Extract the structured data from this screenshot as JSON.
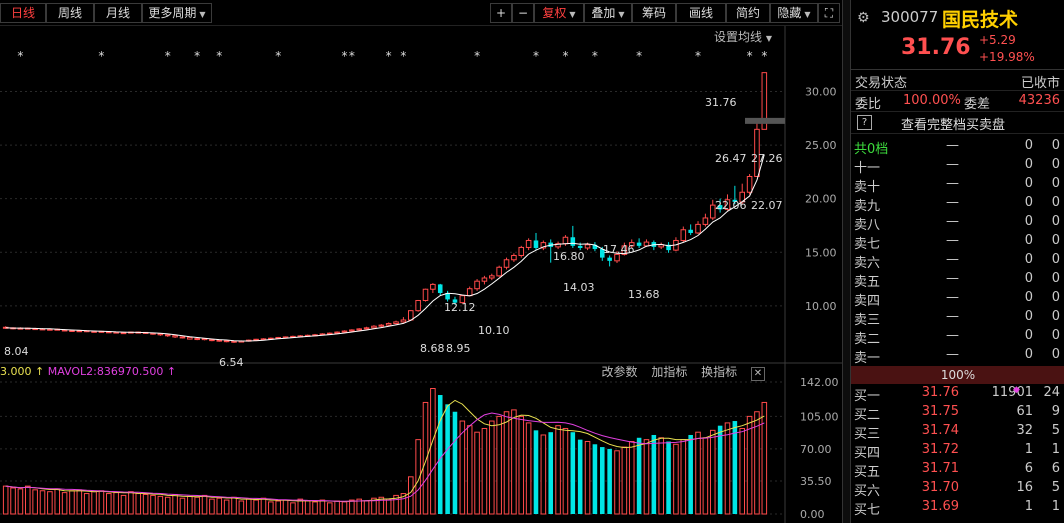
{
  "toolbar": {
    "left_tabs": [
      "日线",
      "周线",
      "月线",
      "更多周期"
    ],
    "plus": "+",
    "minus": "−",
    "fuquan": "复权",
    "diejia": "叠加",
    "chouma": "筹码",
    "huaxian": "画线",
    "jianyue": "简约",
    "yincang": "隐藏",
    "expand": "⛶"
  },
  "ma_settings_label": "设置均线",
  "volume_panel": {
    "legend_m1": "3.000 ↑",
    "legend_m2": "MAVOL2:836970.500 ↑",
    "btn_params": "改参数",
    "btn_add": "加指标",
    "btn_swap": "换指标",
    "close": "✕"
  },
  "header": {
    "code": "300077",
    "name": "国民技术",
    "price": "31.76",
    "change": "+5.29",
    "change_pct": "+19.98%"
  },
  "status": {
    "label": "交易状态",
    "value": "已收市"
  },
  "ratio": {
    "label1": "委比",
    "value1": "100.00%",
    "label2": "委差",
    "value2": "43236"
  },
  "full_book_link": "查看完整档买卖盘",
  "qmark": "?",
  "sell_levels": [
    {
      "name": "共0档",
      "price": "—",
      "vol": "0",
      "cnt": "0"
    },
    {
      "name": "十一",
      "price": "—",
      "vol": "0",
      "cnt": "0"
    },
    {
      "name": "卖十",
      "price": "—",
      "vol": "0",
      "cnt": "0"
    },
    {
      "name": "卖九",
      "price": "—",
      "vol": "0",
      "cnt": "0"
    },
    {
      "name": "卖八",
      "price": "—",
      "vol": "0",
      "cnt": "0"
    },
    {
      "name": "卖七",
      "price": "—",
      "vol": "0",
      "cnt": "0"
    },
    {
      "name": "卖六",
      "price": "—",
      "vol": "0",
      "cnt": "0"
    },
    {
      "name": "卖五",
      "price": "—",
      "vol": "0",
      "cnt": "0"
    },
    {
      "name": "卖四",
      "price": "—",
      "vol": "0",
      "cnt": "0"
    },
    {
      "name": "卖三",
      "price": "—",
      "vol": "0",
      "cnt": "0"
    },
    {
      "name": "卖二",
      "price": "—",
      "vol": "0",
      "cnt": "0"
    },
    {
      "name": "卖一",
      "price": "—",
      "vol": "0",
      "cnt": "0"
    }
  ],
  "pct_label": "100%",
  "buy_levels": [
    {
      "name": "买一",
      "price": "31.76",
      "vol": "11901",
      "cnt": "24",
      "flag": "◆"
    },
    {
      "name": "买二",
      "price": "31.75",
      "vol": "61",
      "cnt": "9",
      "flag": "◆"
    },
    {
      "name": "买三",
      "price": "31.74",
      "vol": "32",
      "cnt": "5",
      "flag": "◆"
    },
    {
      "name": "买四",
      "price": "31.72",
      "vol": "1",
      "cnt": "1",
      "flag": "◆"
    },
    {
      "name": "买五",
      "price": "31.71",
      "vol": "6",
      "cnt": "6",
      "flag": "◆"
    },
    {
      "name": "买六",
      "price": "31.70",
      "vol": "16",
      "cnt": "5",
      "flag": "◆"
    },
    {
      "name": "买七",
      "price": "31.69",
      "vol": "1",
      "cnt": "1",
      "flag": "◆"
    }
  ],
  "colors": {
    "up": "#ff4a4a",
    "down": "#00e5e5",
    "ma1": "#ffffff",
    "vol_ma1": "#e8e050",
    "vol_ma2": "#e040e0"
  },
  "chart_data": [
    {
      "type": "candlestick",
      "y_axis_ticks": [
        "30.00",
        "25.00",
        "20.00",
        "15.00",
        "10.00"
      ],
      "ylim": [
        7.0,
        33.5
      ],
      "annotations": [
        "31.76",
        "26.47",
        "27.26",
        "22.06",
        "22.07",
        "17.46",
        "16.80",
        "14.03",
        "13.68",
        "12.12",
        "10.10",
        "8.04",
        "6.54",
        "8.68",
        "8.95"
      ],
      "markers": [
        "*",
        "*",
        "*",
        "*",
        "*",
        "*",
        "*",
        "*",
        "*",
        "*",
        "*",
        "*",
        "*",
        "*"
      ],
      "candles": [
        [
          8.0,
          7.95,
          8.1,
          7.85,
          1
        ],
        [
          7.95,
          7.9,
          8.0,
          7.8,
          1
        ],
        [
          7.9,
          7.92,
          8.0,
          7.85,
          1
        ],
        [
          7.92,
          7.88,
          7.98,
          7.8,
          1
        ],
        [
          7.88,
          7.85,
          7.95,
          7.78,
          1
        ],
        [
          7.85,
          7.8,
          7.92,
          7.75,
          1
        ],
        [
          7.8,
          7.82,
          7.9,
          7.72,
          1
        ],
        [
          7.82,
          7.75,
          7.88,
          7.7,
          1
        ],
        [
          7.75,
          7.7,
          7.82,
          7.62,
          1
        ],
        [
          7.7,
          7.65,
          7.75,
          7.58,
          1
        ],
        [
          7.65,
          7.68,
          7.75,
          7.6,
          1
        ],
        [
          7.68,
          7.6,
          7.72,
          7.55,
          1
        ],
        [
          7.6,
          7.62,
          7.7,
          7.55,
          1
        ],
        [
          7.62,
          7.58,
          7.66,
          7.5,
          1
        ],
        [
          7.58,
          7.55,
          7.62,
          7.48,
          1
        ],
        [
          7.55,
          7.5,
          7.6,
          7.42,
          1
        ],
        [
          7.5,
          7.48,
          7.55,
          7.4,
          1
        ],
        [
          7.48,
          7.55,
          7.6,
          7.42,
          1
        ],
        [
          7.55,
          7.52,
          7.6,
          7.45,
          1
        ],
        [
          7.52,
          7.45,
          7.56,
          7.38,
          1
        ],
        [
          7.45,
          7.4,
          7.5,
          7.3,
          1
        ],
        [
          7.4,
          7.3,
          7.45,
          7.2,
          1
        ],
        [
          7.3,
          7.22,
          7.35,
          7.1,
          1
        ],
        [
          7.22,
          7.1,
          7.28,
          7.0,
          1
        ],
        [
          7.1,
          7.05,
          7.15,
          6.95,
          1
        ],
        [
          7.05,
          6.9,
          7.1,
          6.85,
          1
        ],
        [
          6.9,
          6.95,
          7.0,
          6.8,
          1
        ],
        [
          6.95,
          6.85,
          7.0,
          6.78,
          1
        ],
        [
          6.85,
          6.8,
          6.9,
          6.7,
          1
        ],
        [
          6.8,
          6.75,
          6.86,
          6.65,
          1
        ],
        [
          6.75,
          6.7,
          6.8,
          6.6,
          1
        ],
        [
          6.7,
          6.62,
          6.75,
          6.54,
          1
        ],
        [
          6.62,
          6.72,
          6.78,
          6.58,
          1
        ],
        [
          6.72,
          6.8,
          6.86,
          6.66,
          1
        ],
        [
          6.8,
          6.88,
          6.92,
          6.75,
          1
        ],
        [
          6.88,
          6.92,
          6.98,
          6.82,
          1
        ],
        [
          6.92,
          6.98,
          7.05,
          6.88,
          1
        ],
        [
          6.98,
          7.05,
          7.1,
          6.92,
          1
        ],
        [
          7.05,
          7.1,
          7.15,
          7.0,
          1
        ],
        [
          7.1,
          7.15,
          7.22,
          7.05,
          1
        ],
        [
          7.15,
          7.2,
          7.28,
          7.1,
          1
        ],
        [
          7.2,
          7.25,
          7.32,
          7.15,
          1
        ],
        [
          7.25,
          7.3,
          7.38,
          7.2,
          1
        ],
        [
          7.3,
          7.38,
          7.45,
          7.25,
          1
        ],
        [
          7.38,
          7.45,
          7.52,
          7.32,
          1
        ],
        [
          7.45,
          7.55,
          7.62,
          7.4,
          1
        ],
        [
          7.55,
          7.65,
          7.72,
          7.5,
          1
        ],
        [
          7.65,
          7.75,
          7.82,
          7.6,
          1
        ],
        [
          7.75,
          7.85,
          7.92,
          7.7,
          1
        ],
        [
          7.85,
          7.95,
          8.05,
          7.8,
          1
        ],
        [
          7.95,
          8.1,
          8.2,
          7.9,
          1
        ],
        [
          8.1,
          8.2,
          8.3,
          8.02,
          1
        ],
        [
          8.2,
          8.35,
          8.45,
          8.12,
          1
        ],
        [
          8.35,
          8.5,
          8.62,
          8.28,
          1
        ],
        [
          8.5,
          8.68,
          8.95,
          8.42,
          1
        ],
        [
          8.68,
          9.55,
          9.6,
          8.6,
          1
        ],
        [
          9.55,
          10.5,
          10.55,
          9.45,
          1
        ],
        [
          10.5,
          11.55,
          11.6,
          10.4,
          1
        ],
        [
          11.55,
          12.0,
          12.12,
          11.2,
          1
        ],
        [
          12.0,
          11.2,
          12.05,
          11.0,
          0
        ],
        [
          11.2,
          10.6,
          11.4,
          10.4,
          0
        ],
        [
          10.6,
          10.3,
          10.85,
          10.1,
          0
        ],
        [
          10.3,
          10.95,
          11.05,
          10.2,
          1
        ],
        [
          10.95,
          11.6,
          11.8,
          10.9,
          1
        ],
        [
          11.6,
          12.3,
          12.5,
          11.4,
          1
        ],
        [
          12.3,
          12.6,
          12.8,
          12.0,
          1
        ],
        [
          12.6,
          12.8,
          13.0,
          12.4,
          1
        ],
        [
          12.8,
          13.6,
          13.75,
          12.7,
          1
        ],
        [
          13.6,
          14.3,
          14.5,
          13.4,
          1
        ],
        [
          14.3,
          14.7,
          14.9,
          14.1,
          1
        ],
        [
          14.7,
          15.45,
          15.6,
          14.5,
          1
        ],
        [
          15.45,
          16.1,
          16.3,
          15.2,
          1
        ],
        [
          16.1,
          15.4,
          16.8,
          15.2,
          0
        ],
        [
          15.4,
          15.9,
          16.1,
          15.2,
          1
        ],
        [
          15.9,
          15.5,
          16.2,
          14.03,
          0
        ],
        [
          15.5,
          15.8,
          16.0,
          15.3,
          1
        ],
        [
          15.8,
          16.4,
          16.6,
          15.6,
          1
        ],
        [
          16.4,
          15.6,
          17.46,
          15.4,
          0
        ],
        [
          15.6,
          15.4,
          15.9,
          15.2,
          0
        ],
        [
          15.4,
          15.7,
          15.9,
          15.2,
          1
        ],
        [
          15.7,
          15.3,
          15.95,
          15.1,
          0
        ],
        [
          15.3,
          14.5,
          15.5,
          14.2,
          0
        ],
        [
          14.5,
          14.2,
          14.7,
          13.68,
          0
        ],
        [
          14.2,
          14.8,
          15.1,
          14.0,
          1
        ],
        [
          14.8,
          15.6,
          15.9,
          14.7,
          1
        ],
        [
          15.6,
          15.9,
          16.2,
          15.4,
          1
        ],
        [
          15.9,
          15.6,
          16.3,
          15.4,
          0
        ],
        [
          15.6,
          15.95,
          16.2,
          15.5,
          1
        ],
        [
          15.95,
          15.5,
          16.1,
          15.2,
          0
        ],
        [
          15.5,
          15.7,
          15.9,
          15.3,
          1
        ],
        [
          15.7,
          15.2,
          15.95,
          14.95,
          0
        ],
        [
          15.2,
          16.1,
          16.4,
          15.1,
          1
        ],
        [
          16.1,
          17.1,
          17.4,
          15.95,
          1
        ],
        [
          17.1,
          16.8,
          17.6,
          16.6,
          0
        ],
        [
          16.8,
          17.6,
          17.9,
          16.7,
          1
        ],
        [
          17.6,
          18.2,
          18.6,
          17.4,
          1
        ],
        [
          18.2,
          19.4,
          19.9,
          18.0,
          1
        ],
        [
          19.4,
          19.0,
          20.0,
          18.7,
          0
        ],
        [
          19.0,
          19.9,
          20.4,
          18.9,
          1
        ],
        [
          19.9,
          19.7,
          21.2,
          19.5,
          0
        ],
        [
          19.7,
          20.6,
          21.4,
          19.5,
          1
        ],
        [
          20.6,
          22.07,
          22.3,
          20.4,
          1
        ],
        [
          22.07,
          26.47,
          27.26,
          22.06,
          1
        ],
        [
          26.47,
          31.76,
          31.76,
          26.47,
          1
        ]
      ]
    },
    {
      "type": "bar",
      "y_axis_ticks": [
        "142.00",
        "105.00",
        "70.00",
        "35.50",
        "0.00"
      ],
      "ylim": [
        0,
        142
      ],
      "values": [
        30,
        28,
        27,
        30,
        26,
        25,
        24,
        27,
        23,
        25,
        26,
        22,
        24,
        25,
        22,
        23,
        20,
        24,
        22,
        21,
        20,
        19,
        18,
        21,
        17,
        19,
        18,
        20,
        16,
        17,
        15,
        18,
        14,
        16,
        15,
        17,
        13,
        14,
        15,
        12,
        16,
        14,
        13,
        15,
        12,
        14,
        13,
        15,
        16,
        14,
        17,
        18,
        16,
        20,
        22,
        40,
        80,
        120,
        135,
        128,
        118,
        110,
        100,
        95,
        88,
        92,
        100,
        105,
        110,
        112,
        105,
        98,
        90,
        85,
        88,
        95,
        92,
        88,
        80,
        78,
        75,
        72,
        70,
        68,
        72,
        78,
        82,
        80,
        85,
        82,
        78,
        75,
        80,
        85,
        88,
        82,
        90,
        95,
        98,
        100,
        92,
        105,
        110,
        120
      ]
    }
  ]
}
